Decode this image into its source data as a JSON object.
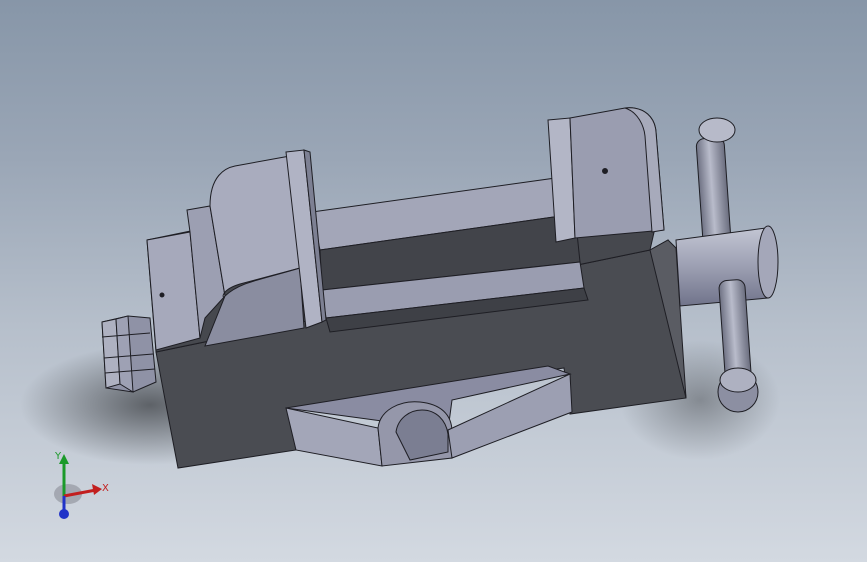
{
  "viewport": {
    "background_top": "#8796a8",
    "background_bottom": "#d3d9e1"
  },
  "model": {
    "name": "",
    "part_color": "#9a9db0",
    "shadow_color": "#4d5054",
    "edge_color": "#1e1e24"
  },
  "triad": {
    "x_label": "X",
    "y_label": "Y",
    "x_color": "#c21f1f",
    "y_color": "#1b9a2a",
    "z_color": "#2033c8"
  }
}
